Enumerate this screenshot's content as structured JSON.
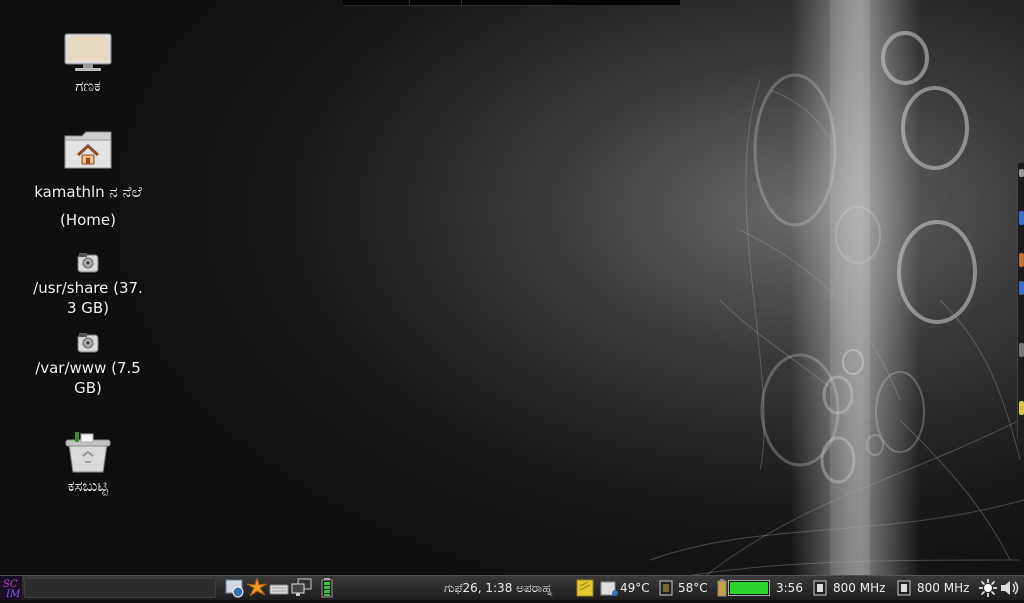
{
  "desktop": {
    "icons": [
      {
        "label": "ಗಣಕ",
        "icon": "computer-icon"
      },
      {
        "label_line1": "kamathln ನ ನೆಲೆ",
        "label_line2": "(Home)",
        "icon": "home-folder-icon"
      },
      {
        "label_line1": "/usr/share (37.",
        "label_line2": "3 GB)",
        "icon": "drive-icon"
      },
      {
        "label_line1": "/var/www (7.5",
        "label_line2": "GB)",
        "icon": "drive-icon"
      },
      {
        "label": "ಕಸಬುಟ್ಟಿ",
        "icon": "trash-icon"
      }
    ]
  },
  "panel": {
    "menu_icon": "scim-menu-icon",
    "launchers": [
      "network-manager-icon",
      "sun-burst-icon",
      "keyboard-icon",
      "network-display-icon",
      "battery-applet-icon"
    ],
    "clock": "ಗುಫೆ26,  1:38 ಅಪರಾಹ್ನ",
    "notes_icon": "sticky-note-icon",
    "temp1": "49°C",
    "temp2": "58°C",
    "battery_time": "3:56",
    "battery_level": 1.0,
    "cpu1": "800 MHz",
    "cpu2": "800 MHz",
    "brightness_icon": "brightness-icon",
    "volume_icon": "volume-icon"
  }
}
